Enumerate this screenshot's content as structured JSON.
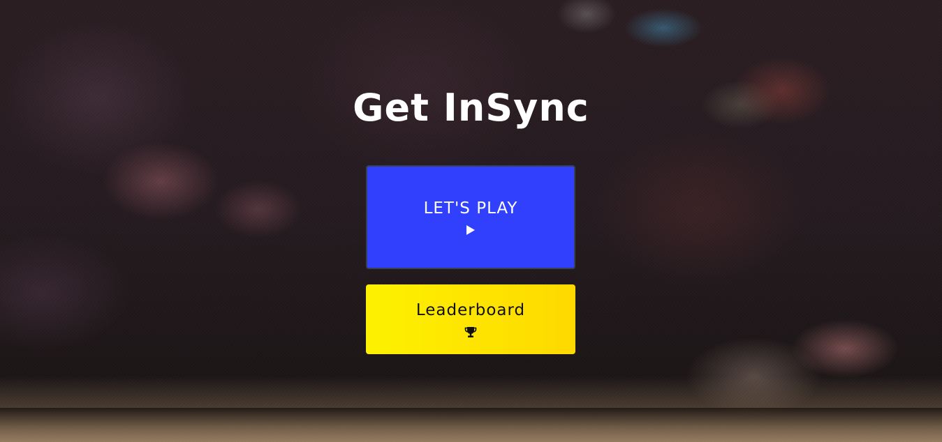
{
  "title": "Get InSync",
  "buttons": {
    "play": {
      "label": "LET'S PLAY",
      "icon": "play-icon",
      "color": "#3140fd"
    },
    "leaderboard": {
      "label": "Leaderboard",
      "icon": "trophy-icon",
      "color": "#fde800"
    }
  }
}
